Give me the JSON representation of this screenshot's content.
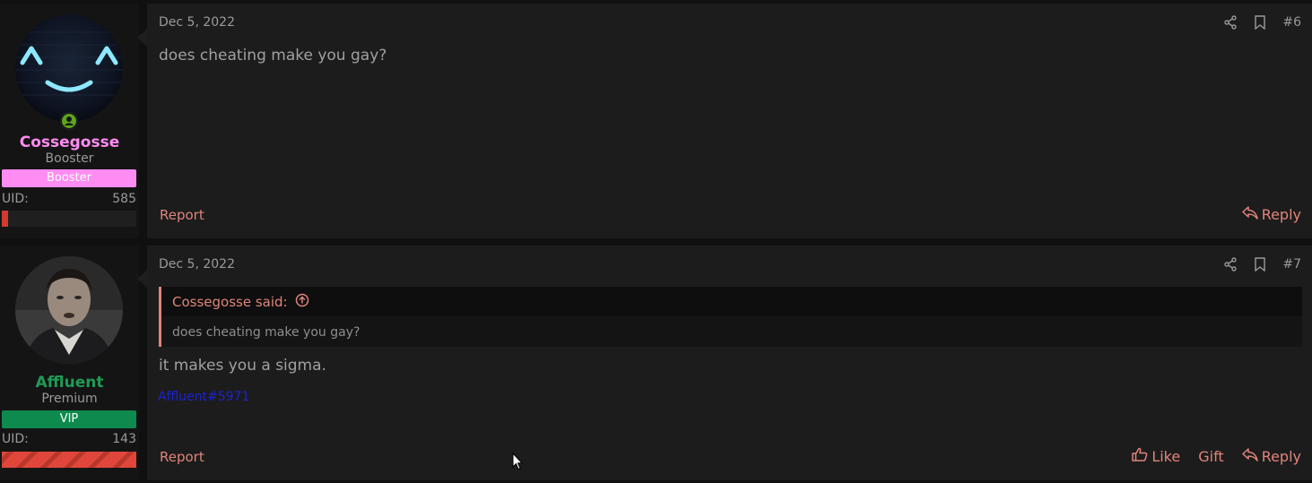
{
  "posts": [
    {
      "date": "Dec 5, 2022",
      "number": "#6",
      "body": "does cheating make you gay?",
      "author": {
        "name": "Cossegosse",
        "title": "Booster",
        "banner": "Booster",
        "uid_label": "UID:",
        "uid_value": "585",
        "name_color": "#ff8cf2",
        "banner_color": "#ff8cf2",
        "online": true
      },
      "actions": {
        "report": "Report",
        "reply": "Reply"
      }
    },
    {
      "date": "Dec 5, 2022",
      "number": "#7",
      "quote": {
        "author": "Cossegosse said:",
        "text": "does cheating make you gay?"
      },
      "body": "it makes you a sigma.",
      "signature": "Affluent#5971",
      "author": {
        "name": "Affluent",
        "title": "Premium",
        "banner": "VIP",
        "uid_label": "UID:",
        "uid_value": "143",
        "name_color": "#1f9a56",
        "banner_color": "#0e8a4e"
      },
      "actions": {
        "report": "Report",
        "like": "Like",
        "gift": "Gift",
        "reply": "Reply"
      }
    }
  ],
  "icons": [
    "share-icon",
    "bookmark-icon",
    "reply-icon",
    "like-icon",
    "arrow-up-circle-icon",
    "online-user-icon",
    "cursor-icon"
  ],
  "colors": {
    "accent": "#e0847a",
    "background": "#101010",
    "panel": "#1c1c1c"
  }
}
